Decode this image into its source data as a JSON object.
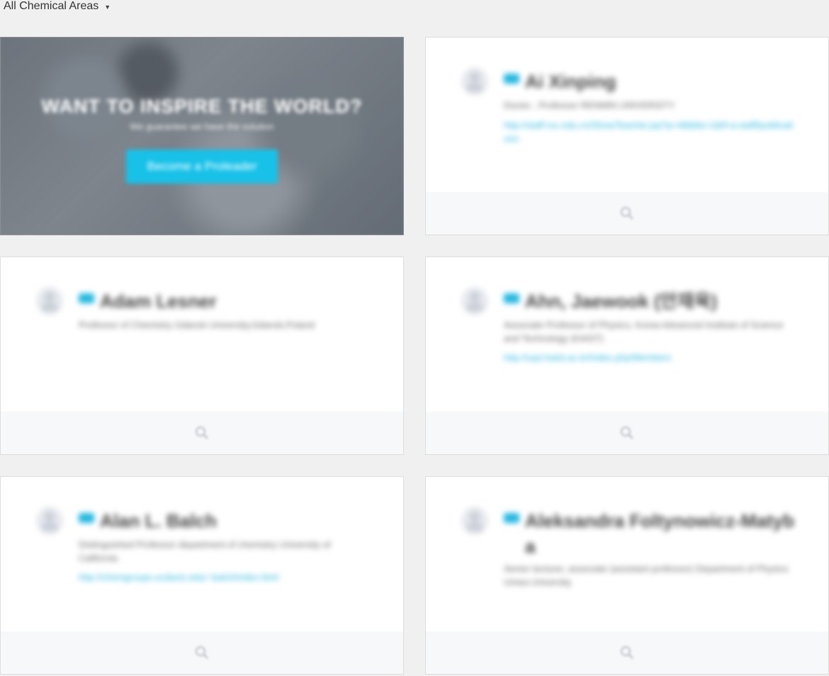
{
  "filter": {
    "label": "All Chemical Areas"
  },
  "promo": {
    "title": "WANT TO INSPIRE THE WORLD?",
    "subtitle": "We guarantee we have the solution",
    "button_label": "Become a Proleader"
  },
  "cards": [
    {
      "name": "Ai Xinping",
      "description": "Doctor , Professor RENMIN UNIVERSITY",
      "link": "http://staff.ruc.edu.cn/ShowTeacher.jsp?p=48&tfa=1&tf=a-staff/publications"
    },
    {
      "name": "Adam Lesner",
      "description": "Professor of Chemistry Gdansk University,Gdansk,Poland",
      "link": ""
    },
    {
      "name": "Ahn, Jaewook (안재욱)",
      "description": "Associate Professor of Physics, Korea Advanced Institute of Science and Technology (KAIST)",
      "link": "http://uqcl.kaist.ac.kr/index.php/Members"
    },
    {
      "name": "Alan L. Balch",
      "description": "Distinguished Professor department of chemistry University of California",
      "link": "http://chemgroups.ucdavis.edu/~balch/index.html"
    },
    {
      "name": "Aleksandra Foltynowicz-Matyba",
      "description": "Senior lecturer, associate (assistant professor) Department of Physics Umea University",
      "link": ""
    }
  ]
}
